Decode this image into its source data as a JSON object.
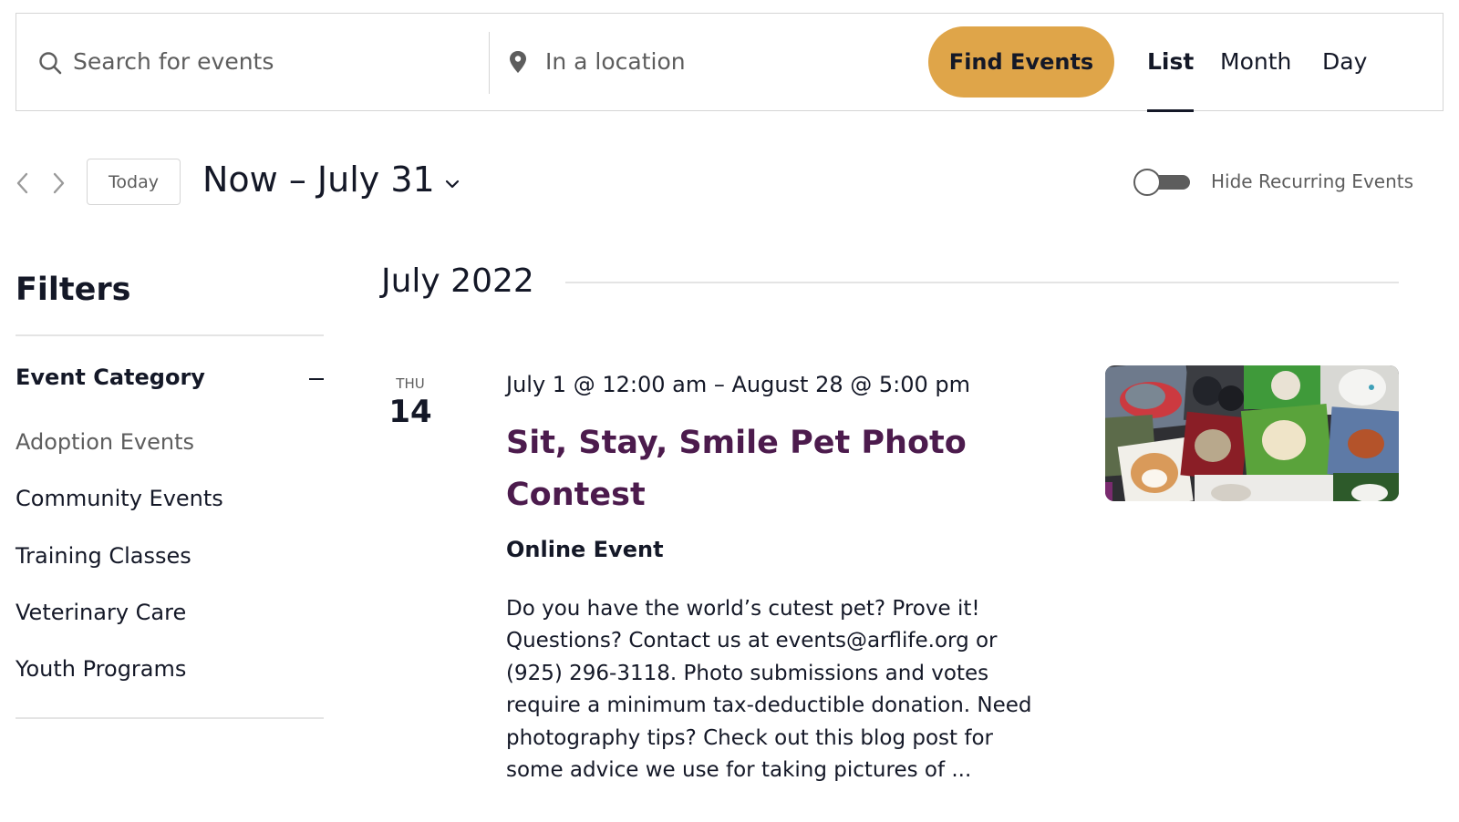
{
  "search": {
    "keyword_placeholder": "Search for events",
    "location_placeholder": "In a location",
    "find_button": "Find Events"
  },
  "views": [
    "List",
    "Month",
    "Day"
  ],
  "active_view": "List",
  "nav": {
    "today_label": "Today",
    "date_range": "Now – July 31",
    "hide_recurring_label": "Hide Recurring Events",
    "hide_recurring_on": false
  },
  "filters": {
    "title": "Filters",
    "category_title": "Event Category",
    "categories": [
      "Adoption Events",
      "Community Events",
      "Training Classes",
      "Veterinary Care",
      "Youth Programs"
    ]
  },
  "month_header": "July 2022",
  "event": {
    "weekday": "THU",
    "day": "14",
    "datetime": "July 1 @ 12:00 am – August 28 @ 5:00 pm",
    "title": "Sit, Stay, Smile Pet Photo Contest",
    "venue": "Online Event",
    "description": "Do you have the world’s cutest pet? Prove it! Questions? Contact us at events@arflife.org or (925) 296-3118. Photo submissions and votes require a minimum tax-deductible donation. Need photography tips? Check out this blog post for some advice we use for taking pictures of ...",
    "image_icon": "pet-photo-collage-image"
  },
  "colors": {
    "accent": "#dfa549",
    "event_title": "#4c1b4d",
    "text": "#141827",
    "muted": "#5d5d5d"
  }
}
